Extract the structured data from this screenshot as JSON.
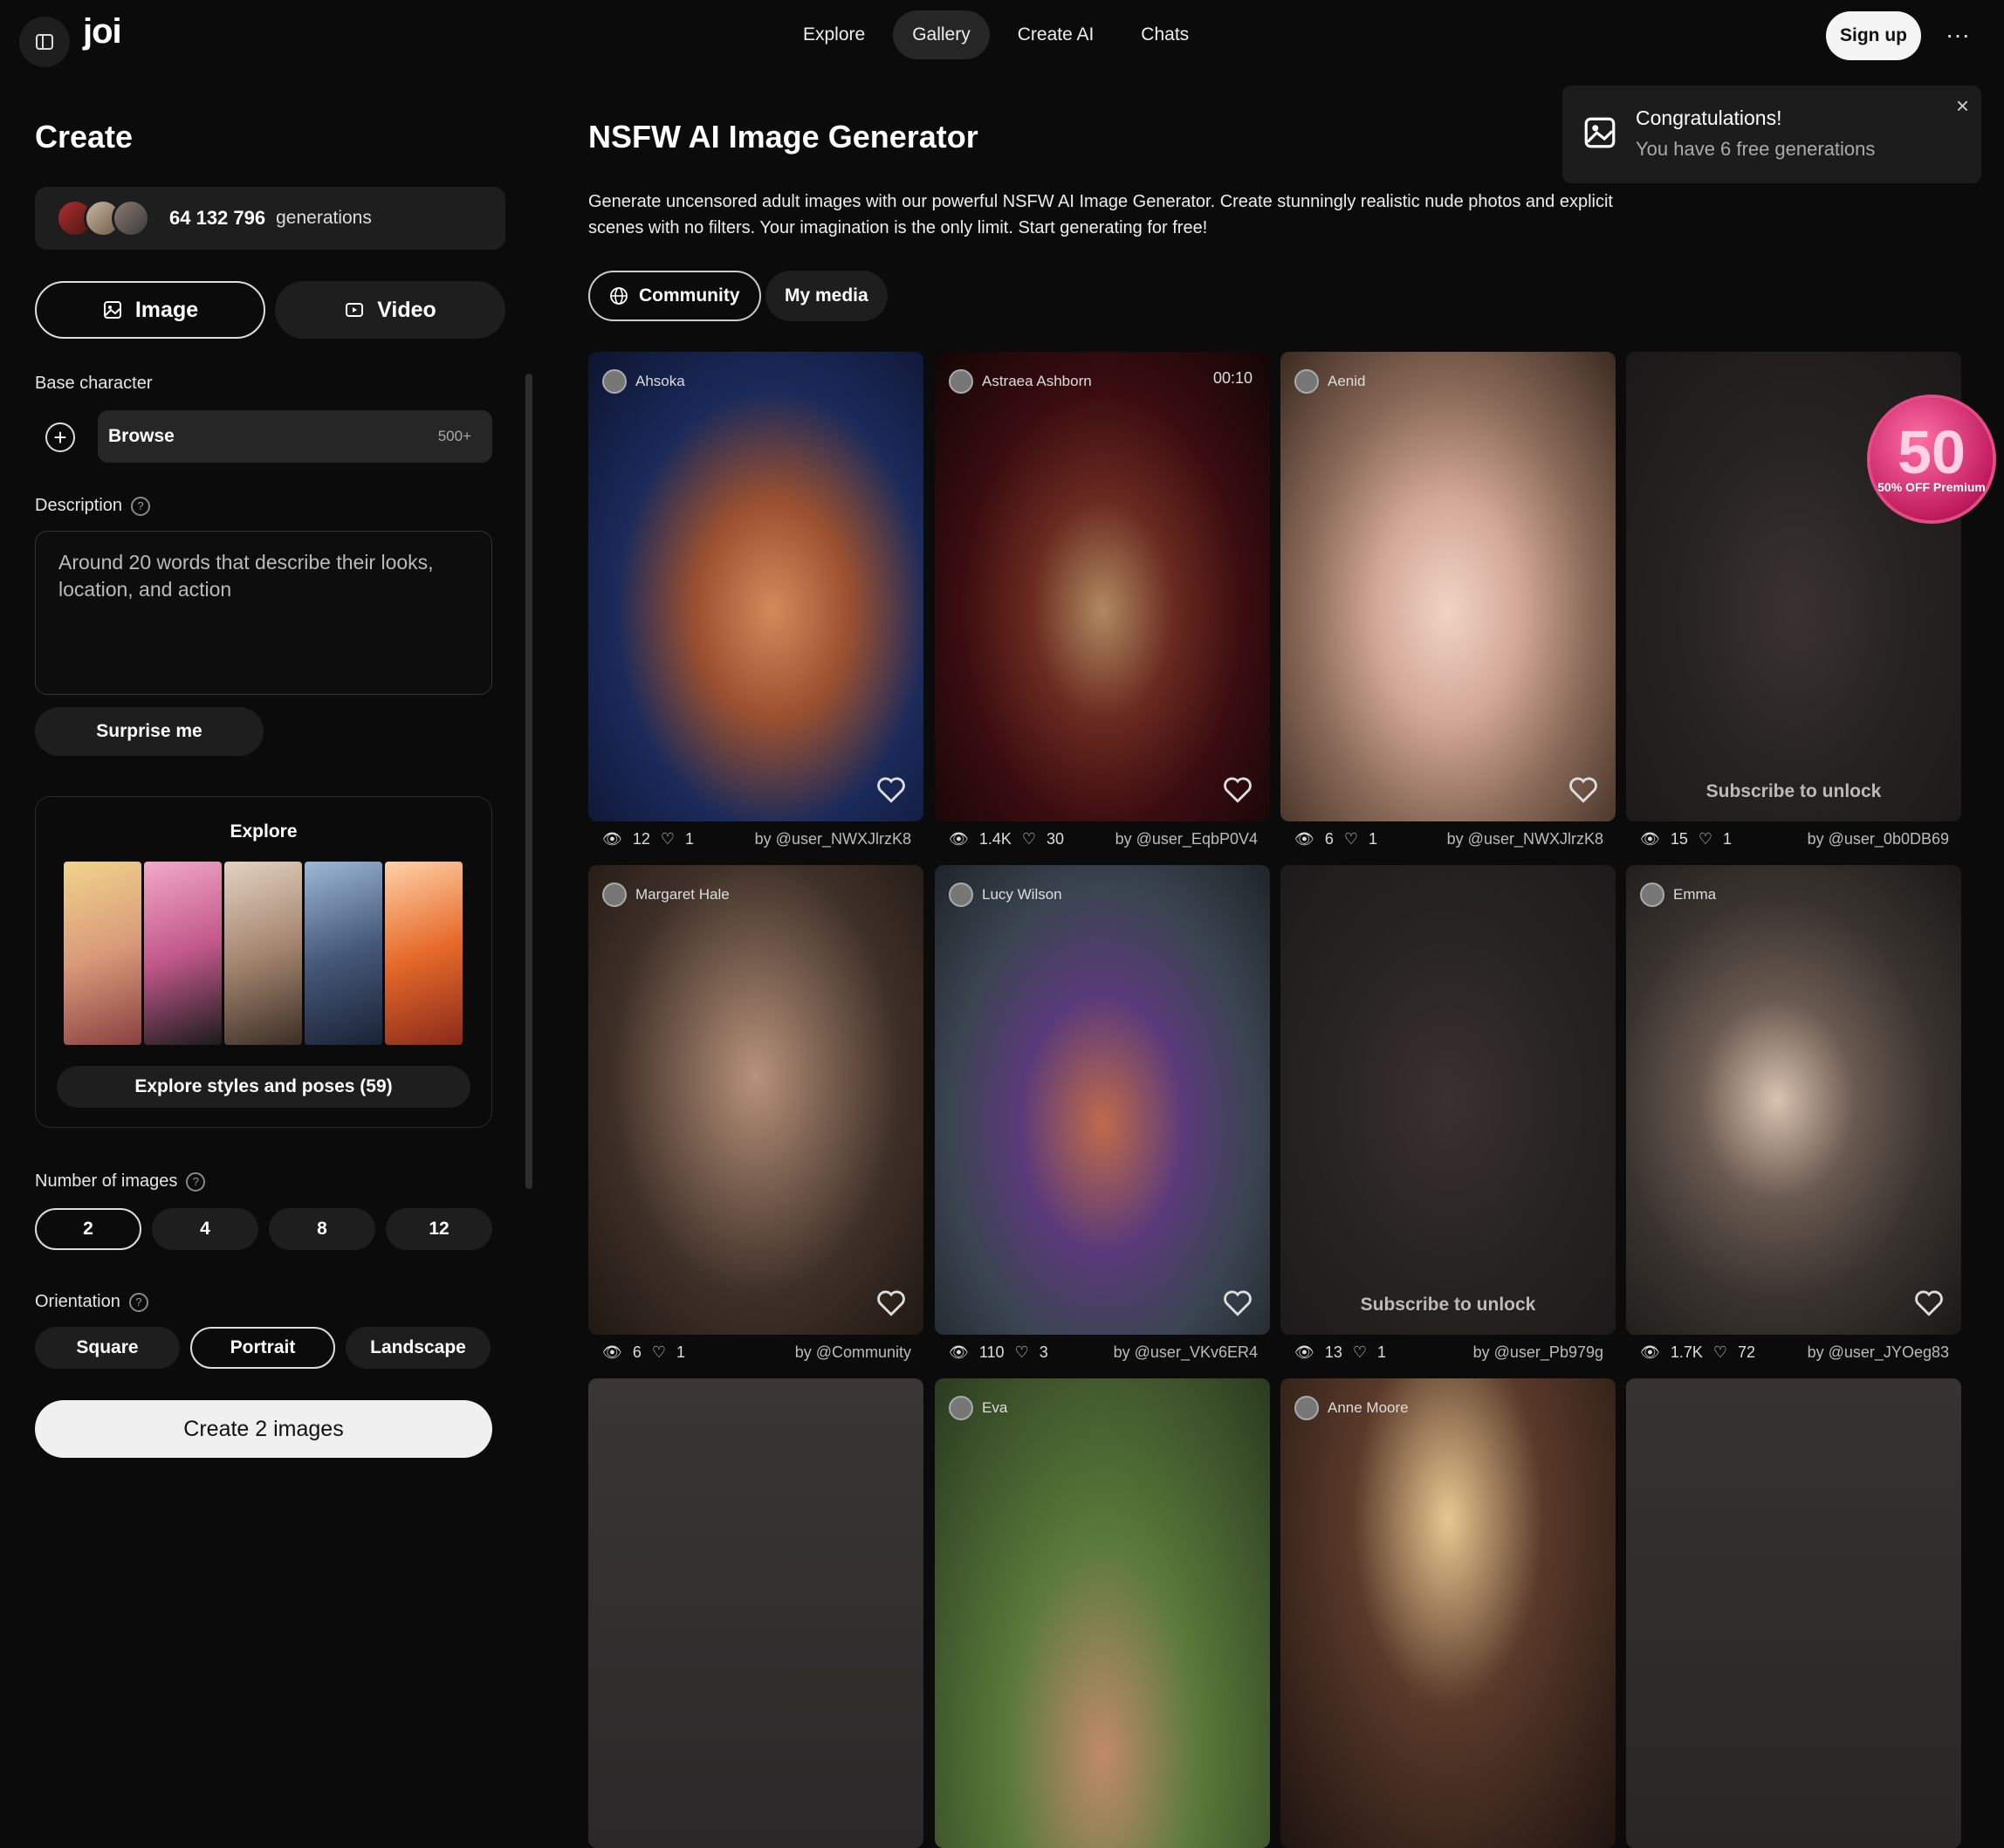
{
  "header": {
    "logo": "joi",
    "nav": [
      "Explore",
      "Gallery",
      "Create AI",
      "Chats"
    ],
    "active_nav": "Gallery",
    "signup": "Sign up",
    "more": "···"
  },
  "sidebar": {
    "title": "Create",
    "gen_count": "64 132 796",
    "gen_label": "generations",
    "mode_image": "Image",
    "mode_video": "Video",
    "base_character_label": "Base character",
    "browse_label": "Browse",
    "browse_count": "500+",
    "description_label": "Description",
    "description_placeholder": "Around 20 words that describe their looks, location, and action",
    "surprise": "Surprise me",
    "explore_title": "Explore",
    "explore_button": "Explore styles and poses (59)",
    "num_images_label": "Number of images",
    "num_images_options": [
      "2",
      "4",
      "8",
      "12"
    ],
    "num_images_selected": "2",
    "orientation_label": "Orientation",
    "orientation_options": [
      "Square",
      "Portrait",
      "Landscape"
    ],
    "orientation_selected": "Portrait",
    "create_button": "Create 2 images"
  },
  "main": {
    "title": "NSFW AI Image Generator",
    "intro": "Generate uncensored adult images with our powerful NSFW AI Image Generator. Create stunningly realistic nude photos and explicit scenes with no filters. Your imagination is the only limit. Start generating for free!",
    "filter_community": "Community",
    "filter_my_media": "My media"
  },
  "toast": {
    "title": "Congratulations!",
    "subtitle": "You have 6 free generations",
    "close": "×"
  },
  "promo": {
    "big": "50",
    "small": "50% OFF Premium"
  },
  "cards": [
    {
      "name": "Ahsoka",
      "views": "12",
      "likes": "1",
      "by": "by @user_NWXJlrzK8",
      "locked": false
    },
    {
      "name": "Astraea Ashborn",
      "views": "1.4K",
      "likes": "30",
      "by": "by @user_EqbP0V4",
      "locked": false,
      "timer": "00:10"
    },
    {
      "name": "Aenid",
      "views": "6",
      "likes": "1",
      "by": "by @user_NWXJlrzK8",
      "locked": false
    },
    {
      "name": "",
      "views": "15",
      "likes": "1",
      "by": "by @user_0b0DB69",
      "locked": true,
      "lock_text": "Subscribe to unlock"
    },
    {
      "name": "Margaret Hale",
      "views": "6",
      "likes": "1",
      "by": "by @Community",
      "locked": false
    },
    {
      "name": "Lucy Wilson",
      "views": "110",
      "likes": "3",
      "by": "by @user_VKv6ER4",
      "locked": false
    },
    {
      "name": "",
      "views": "13",
      "likes": "1",
      "by": "by @user_Pb979g",
      "locked": true,
      "lock_text": "Subscribe to unlock"
    },
    {
      "name": "Emma",
      "views": "1.7K",
      "likes": "72",
      "by": "by @user_JYOeg83",
      "locked": false
    },
    {
      "name": "",
      "locked": true
    },
    {
      "name": "Eva",
      "locked": false
    },
    {
      "name": "Anne Moore",
      "locked": false
    },
    {
      "name": "",
      "locked": true
    }
  ]
}
